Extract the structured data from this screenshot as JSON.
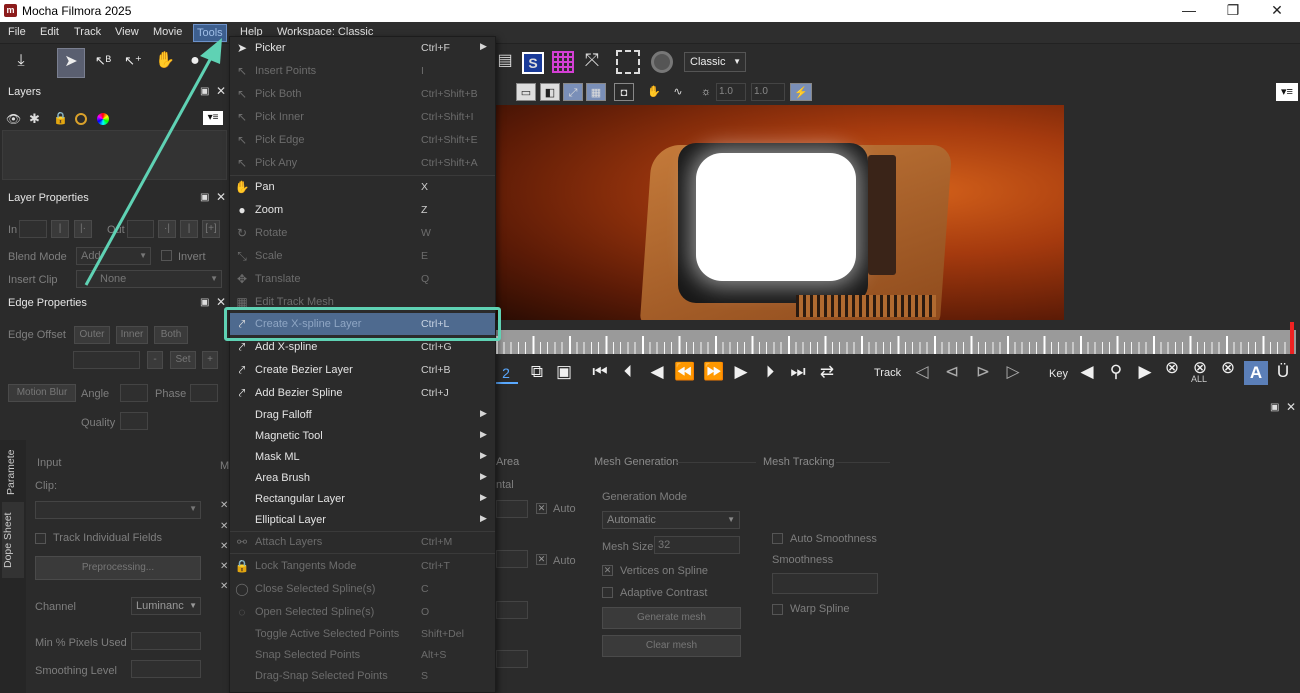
{
  "window": {
    "title": "Mocha Filmora 2025",
    "logo_text": "m",
    "minimize": "—",
    "maximize": "❐",
    "close": "✕"
  },
  "menubar": [
    "File",
    "Edit",
    "Track",
    "View",
    "Movie",
    "Tools",
    "Help",
    "Workspace: Classic"
  ],
  "toolbar": {
    "workspace_select": "Classic",
    "gain_value": "1.0",
    "gain_value2": "1.0"
  },
  "layers_panel": {
    "title": "Layers"
  },
  "layer_properties": {
    "title": "Layer Properties",
    "in_label": "In",
    "out_label": "Out",
    "blend_mode_label": "Blend Mode",
    "blend_mode_value": "Add",
    "invert_label": "Invert",
    "insert_clip_label": "Insert Clip",
    "insert_clip_value": "None"
  },
  "edge_properties": {
    "title": "Edge Properties",
    "edge_offset_label": "Edge Offset",
    "outer_btn": "Outer",
    "inner_btn": "Inner",
    "both_btn": "Both",
    "set_btn": "Set",
    "motion_blur_btn": "Motion Blur",
    "angle_label": "Angle",
    "phase_label": "Phase",
    "quality_label": "Quality"
  },
  "side_tabs": [
    "Paramete",
    "Dope Sheet"
  ],
  "input_panel": {
    "input_label": "Input",
    "clip_label": "Clip:",
    "track_individual_fields": "Track Individual Fields",
    "preprocessing_btn": "Preprocessing...",
    "channel_label": "Channel",
    "channel_value": "Luminanc",
    "min_pixels_label": "Min % Pixels Used",
    "smoothing_level_label": "Smoothing Level",
    "m_tab": "M"
  },
  "tools_menu": [
    {
      "label": "Picker",
      "shortcut": "Ctrl+F",
      "enabled": true,
      "submenu": true,
      "icon": "pointer"
    },
    {
      "label": "Insert Points",
      "shortcut": "I",
      "enabled": false,
      "icon": "pointer-plus"
    },
    {
      "label": "Pick Both",
      "shortcut": "Ctrl+Shift+B",
      "enabled": false,
      "icon": "pointer-both"
    },
    {
      "label": "Pick Inner",
      "shortcut": "Ctrl+Shift+I",
      "enabled": false,
      "icon": "pointer-inner"
    },
    {
      "label": "Pick Edge",
      "shortcut": "Ctrl+Shift+E",
      "enabled": false,
      "icon": "pointer-edge"
    },
    {
      "label": "Pick Any",
      "shortcut": "Ctrl+Shift+A",
      "enabled": false,
      "icon": "pointer-any"
    },
    {
      "label": "Pan",
      "shortcut": "X",
      "enabled": true,
      "icon": "hand"
    },
    {
      "label": "Zoom",
      "shortcut": "Z",
      "enabled": true,
      "icon": "magnifier"
    },
    {
      "label": "Rotate",
      "shortcut": "W",
      "enabled": false,
      "icon": "rotate"
    },
    {
      "label": "Scale",
      "shortcut": "E",
      "enabled": false,
      "icon": "scale"
    },
    {
      "label": "Translate",
      "shortcut": "Q",
      "enabled": false,
      "icon": "move"
    },
    {
      "label": "Edit Track Mesh",
      "shortcut": "",
      "enabled": false,
      "icon": "mesh"
    },
    {
      "label": "Create X-spline Layer",
      "shortcut": "Ctrl+L",
      "enabled": true,
      "highlighted": true,
      "icon": "xspline-layer"
    },
    {
      "label": "Add X-spline",
      "shortcut": "Ctrl+G",
      "enabled": true,
      "icon": "xspline-add"
    },
    {
      "label": "Create Bezier Layer",
      "shortcut": "Ctrl+B",
      "enabled": true,
      "icon": "bezier-layer"
    },
    {
      "label": "Add Bezier Spline",
      "shortcut": "Ctrl+J",
      "enabled": true,
      "icon": "bezier-add"
    },
    {
      "label": "Drag Falloff",
      "shortcut": "",
      "enabled": true,
      "submenu": true
    },
    {
      "label": "Magnetic Tool",
      "shortcut": "",
      "enabled": true,
      "submenu": true
    },
    {
      "label": "Mask ML",
      "shortcut": "",
      "enabled": true,
      "submenu": true
    },
    {
      "label": "Area Brush",
      "shortcut": "",
      "enabled": true,
      "submenu": true
    },
    {
      "label": "Rectangular Layer",
      "shortcut": "",
      "enabled": true,
      "submenu": true
    },
    {
      "label": "Elliptical Layer",
      "shortcut": "",
      "enabled": true,
      "submenu": true
    },
    {
      "label": "Attach Layers",
      "shortcut": "Ctrl+M",
      "enabled": false,
      "icon": "attach"
    },
    {
      "label": "Lock Tangents Mode",
      "shortcut": "Ctrl+T",
      "enabled": false,
      "icon": "lock"
    },
    {
      "label": "Close Selected Spline(s)",
      "shortcut": "C",
      "enabled": false,
      "icon": "circle-closed"
    },
    {
      "label": "Open Selected Spline(s)",
      "shortcut": "O",
      "enabled": false,
      "icon": "circle-open"
    },
    {
      "label": "Toggle Active Selected Points",
      "shortcut": "Shift+Del",
      "enabled": false
    },
    {
      "label": "Snap Selected Points",
      "shortcut": "Alt+S",
      "enabled": false
    },
    {
      "label": "Drag-Snap Selected Points",
      "shortcut": "S",
      "enabled": false
    }
  ],
  "transport": {
    "frame": "2",
    "track_label": "Track",
    "key_label": "Key",
    "all_label": "ALL"
  },
  "lower_panel": {
    "area_header": "Area",
    "ntal_label": "ntal",
    "auto_label_1": "Auto",
    "auto_label_2": "Auto",
    "mesh_generation": {
      "header": "Mesh Generation",
      "generation_mode_label": "Generation Mode",
      "generation_mode_value": "Automatic",
      "mesh_size_label": "Mesh Size",
      "mesh_size_value": "32",
      "vertices_on_spline": "Vertices on Spline",
      "adaptive_contrast": "Adaptive Contrast",
      "generate_mesh_btn": "Generate mesh",
      "clear_mesh_btn": "Clear mesh"
    },
    "mesh_tracking": {
      "header": "Mesh Tracking",
      "auto_smoothness": "Auto Smoothness",
      "smoothness_label": "Smoothness",
      "warp_spline": "Warp Spline"
    }
  },
  "colors": {
    "accent_highlight": "#5fd2b4",
    "menu_hover": "#4e6a8f",
    "panel_bg": "#2b2b2b"
  }
}
